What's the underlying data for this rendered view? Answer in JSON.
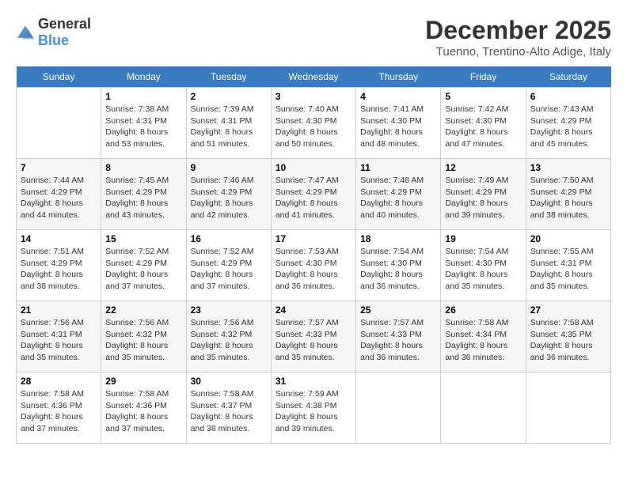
{
  "logo": {
    "general": "General",
    "blue": "Blue"
  },
  "title": "December 2025",
  "subtitle": "Tuenno, Trentino-Alto Adige, Italy",
  "headers": [
    "Sunday",
    "Monday",
    "Tuesday",
    "Wednesday",
    "Thursday",
    "Friday",
    "Saturday"
  ],
  "weeks": [
    [
      {
        "day": "",
        "sunrise": "",
        "sunset": "",
        "daylight": ""
      },
      {
        "day": "1",
        "sunrise": "Sunrise: 7:38 AM",
        "sunset": "Sunset: 4:31 PM",
        "daylight": "Daylight: 8 hours and 53 minutes."
      },
      {
        "day": "2",
        "sunrise": "Sunrise: 7:39 AM",
        "sunset": "Sunset: 4:31 PM",
        "daylight": "Daylight: 8 hours and 51 minutes."
      },
      {
        "day": "3",
        "sunrise": "Sunrise: 7:40 AM",
        "sunset": "Sunset: 4:30 PM",
        "daylight": "Daylight: 8 hours and 50 minutes."
      },
      {
        "day": "4",
        "sunrise": "Sunrise: 7:41 AM",
        "sunset": "Sunset: 4:30 PM",
        "daylight": "Daylight: 8 hours and 48 minutes."
      },
      {
        "day": "5",
        "sunrise": "Sunrise: 7:42 AM",
        "sunset": "Sunset: 4:30 PM",
        "daylight": "Daylight: 8 hours and 47 minutes."
      },
      {
        "day": "6",
        "sunrise": "Sunrise: 7:43 AM",
        "sunset": "Sunset: 4:29 PM",
        "daylight": "Daylight: 8 hours and 45 minutes."
      }
    ],
    [
      {
        "day": "7",
        "sunrise": "Sunrise: 7:44 AM",
        "sunset": "Sunset: 4:29 PM",
        "daylight": "Daylight: 8 hours and 44 minutes."
      },
      {
        "day": "8",
        "sunrise": "Sunrise: 7:45 AM",
        "sunset": "Sunset: 4:29 PM",
        "daylight": "Daylight: 8 hours and 43 minutes."
      },
      {
        "day": "9",
        "sunrise": "Sunrise: 7:46 AM",
        "sunset": "Sunset: 4:29 PM",
        "daylight": "Daylight: 8 hours and 42 minutes."
      },
      {
        "day": "10",
        "sunrise": "Sunrise: 7:47 AM",
        "sunset": "Sunset: 4:29 PM",
        "daylight": "Daylight: 8 hours and 41 minutes."
      },
      {
        "day": "11",
        "sunrise": "Sunrise: 7:48 AM",
        "sunset": "Sunset: 4:29 PM",
        "daylight": "Daylight: 8 hours and 40 minutes."
      },
      {
        "day": "12",
        "sunrise": "Sunrise: 7:49 AM",
        "sunset": "Sunset: 4:29 PM",
        "daylight": "Daylight: 8 hours and 39 minutes."
      },
      {
        "day": "13",
        "sunrise": "Sunrise: 7:50 AM",
        "sunset": "Sunset: 4:29 PM",
        "daylight": "Daylight: 8 hours and 38 minutes."
      }
    ],
    [
      {
        "day": "14",
        "sunrise": "Sunrise: 7:51 AM",
        "sunset": "Sunset: 4:29 PM",
        "daylight": "Daylight: 8 hours and 38 minutes."
      },
      {
        "day": "15",
        "sunrise": "Sunrise: 7:52 AM",
        "sunset": "Sunset: 4:29 PM",
        "daylight": "Daylight: 8 hours and 37 minutes."
      },
      {
        "day": "16",
        "sunrise": "Sunrise: 7:52 AM",
        "sunset": "Sunset: 4:29 PM",
        "daylight": "Daylight: 8 hours and 37 minutes."
      },
      {
        "day": "17",
        "sunrise": "Sunrise: 7:53 AM",
        "sunset": "Sunset: 4:30 PM",
        "daylight": "Daylight: 8 hours and 36 minutes."
      },
      {
        "day": "18",
        "sunrise": "Sunrise: 7:54 AM",
        "sunset": "Sunset: 4:30 PM",
        "daylight": "Daylight: 8 hours and 36 minutes."
      },
      {
        "day": "19",
        "sunrise": "Sunrise: 7:54 AM",
        "sunset": "Sunset: 4:30 PM",
        "daylight": "Daylight: 8 hours and 35 minutes."
      },
      {
        "day": "20",
        "sunrise": "Sunrise: 7:55 AM",
        "sunset": "Sunset: 4:31 PM",
        "daylight": "Daylight: 8 hours and 35 minutes."
      }
    ],
    [
      {
        "day": "21",
        "sunrise": "Sunrise: 7:56 AM",
        "sunset": "Sunset: 4:31 PM",
        "daylight": "Daylight: 8 hours and 35 minutes."
      },
      {
        "day": "22",
        "sunrise": "Sunrise: 7:56 AM",
        "sunset": "Sunset: 4:32 PM",
        "daylight": "Daylight: 8 hours and 35 minutes."
      },
      {
        "day": "23",
        "sunrise": "Sunrise: 7:56 AM",
        "sunset": "Sunset: 4:32 PM",
        "daylight": "Daylight: 8 hours and 35 minutes."
      },
      {
        "day": "24",
        "sunrise": "Sunrise: 7:57 AM",
        "sunset": "Sunset: 4:33 PM",
        "daylight": "Daylight: 8 hours and 35 minutes."
      },
      {
        "day": "25",
        "sunrise": "Sunrise: 7:57 AM",
        "sunset": "Sunset: 4:33 PM",
        "daylight": "Daylight: 8 hours and 36 minutes."
      },
      {
        "day": "26",
        "sunrise": "Sunrise: 7:58 AM",
        "sunset": "Sunset: 4:34 PM",
        "daylight": "Daylight: 8 hours and 36 minutes."
      },
      {
        "day": "27",
        "sunrise": "Sunrise: 7:58 AM",
        "sunset": "Sunset: 4:35 PM",
        "daylight": "Daylight: 8 hours and 36 minutes."
      }
    ],
    [
      {
        "day": "28",
        "sunrise": "Sunrise: 7:58 AM",
        "sunset": "Sunset: 4:36 PM",
        "daylight": "Daylight: 8 hours and 37 minutes."
      },
      {
        "day": "29",
        "sunrise": "Sunrise: 7:58 AM",
        "sunset": "Sunset: 4:36 PM",
        "daylight": "Daylight: 8 hours and 37 minutes."
      },
      {
        "day": "30",
        "sunrise": "Sunrise: 7:58 AM",
        "sunset": "Sunset: 4:37 PM",
        "daylight": "Daylight: 8 hours and 38 minutes."
      },
      {
        "day": "31",
        "sunrise": "Sunrise: 7:59 AM",
        "sunset": "Sunset: 4:38 PM",
        "daylight": "Daylight: 8 hours and 39 minutes."
      },
      {
        "day": "",
        "sunrise": "",
        "sunset": "",
        "daylight": ""
      },
      {
        "day": "",
        "sunrise": "",
        "sunset": "",
        "daylight": ""
      },
      {
        "day": "",
        "sunrise": "",
        "sunset": "",
        "daylight": ""
      }
    ]
  ]
}
